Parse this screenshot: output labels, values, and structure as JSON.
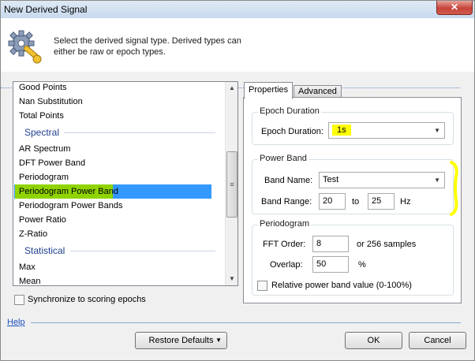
{
  "window": {
    "title": "New Derived Signal",
    "close_glyph": "✕"
  },
  "header": {
    "text": "Select the derived signal type. Derived types can either be raw or epoch types.",
    "icon": "gear-wrench-icon"
  },
  "signal_list": {
    "items": [
      {
        "label": "Good Points",
        "type": "item"
      },
      {
        "label": "Nan Substitution",
        "type": "item"
      },
      {
        "label": "Total Points",
        "type": "item"
      },
      {
        "label": "Spectral",
        "type": "category"
      },
      {
        "label": "AR Spectrum",
        "type": "item"
      },
      {
        "label": "DFT Power Band",
        "type": "item"
      },
      {
        "label": "Periodogram",
        "type": "item"
      },
      {
        "label": "Periodogram Power Band",
        "type": "item",
        "selected": true
      },
      {
        "label": "Periodogram Power Bands",
        "type": "item"
      },
      {
        "label": "Power Ratio",
        "type": "item"
      },
      {
        "label": "Z-Ratio",
        "type": "item"
      },
      {
        "label": "Statistical",
        "type": "category"
      },
      {
        "label": "Max",
        "type": "item"
      },
      {
        "label": "Mean",
        "type": "item"
      }
    ],
    "scrollbar": {
      "grip_glyph": "≡"
    }
  },
  "sync_checkbox": {
    "label": "Synchronize to scoring epochs",
    "checked": false
  },
  "tabs": [
    {
      "label": "Properties",
      "active": true
    },
    {
      "label": "Advanced",
      "active": false
    }
  ],
  "epoch_duration": {
    "group_label": "Epoch Duration",
    "field_label": "Epoch Duration:",
    "value": "1s"
  },
  "power_band": {
    "group_label": "Power Band",
    "band_name_label": "Band Name:",
    "band_name_value": "Test",
    "band_range_label": "Band Range:",
    "range_from": "20",
    "to_label": "to",
    "range_to": "25",
    "unit": "Hz"
  },
  "periodogram": {
    "group_label": "Periodogram",
    "fft_order_label": "FFT Order:",
    "fft_order_value": "8",
    "samples_text": "or 256 samples",
    "overlap_label": "Overlap:",
    "overlap_value": "50",
    "overlap_unit": "%",
    "relative_label": "Relative power band value (0-100%)",
    "relative_checked": false
  },
  "footer": {
    "help": "Help",
    "restore_defaults": "Restore Defaults",
    "ok": "OK",
    "cancel": "Cancel"
  },
  "colors": {
    "selection_blue": "#3399ff",
    "highlight_green": "#8fd400",
    "annotation_yellow": "#ffff00",
    "category_blue": "#1f3f8f"
  }
}
